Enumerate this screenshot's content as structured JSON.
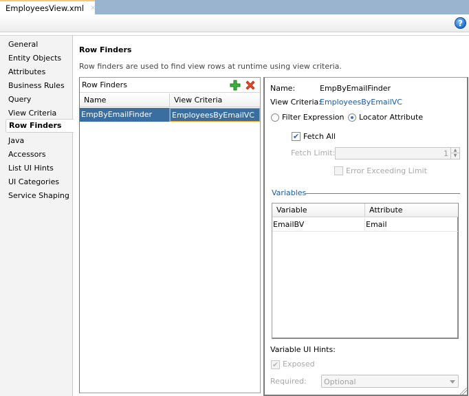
{
  "tab": {
    "title": "EmployeesView.xml",
    "close_glyph": "×"
  },
  "toolbar": {
    "help_glyph": "?"
  },
  "nav": {
    "items": [
      {
        "label": "General"
      },
      {
        "label": "Entity Objects"
      },
      {
        "label": "Attributes"
      },
      {
        "label": "Business Rules"
      },
      {
        "label": "Query"
      },
      {
        "label": "View Criteria"
      },
      {
        "label": "Row Finders"
      },
      {
        "label": "Java"
      },
      {
        "label": "Accessors"
      },
      {
        "label": "List UI Hints"
      },
      {
        "label": "UI Categories"
      },
      {
        "label": "Service Shaping"
      }
    ],
    "active": "Row Finders"
  },
  "main": {
    "title": "Row Finders",
    "description": "Row finders are used to find view rows at runtime using view criteria.",
    "finders_table": {
      "header": "Row Finders",
      "columns": [
        "Name",
        "View Criteria"
      ],
      "rows": [
        {
          "name": "EmpByEmailFinder",
          "view_criteria": "EmployeesByEmailVC",
          "selected": true
        }
      ]
    }
  },
  "detail": {
    "name_label": "Name:",
    "name_value": "EmpByEmailFinder",
    "vc_label": "View Criteria:",
    "vc_value": "EmployeesByEmailVC",
    "radio_filter": "Filter Expression",
    "radio_locator": "Locator Attribute",
    "radio_selected": "Locator Attribute",
    "fetch_all_label": "Fetch All",
    "fetch_all_checked": true,
    "fetch_limit_label": "Fetch Limit:",
    "fetch_limit_value": "1",
    "error_exceeding_label": "Error Exceeding Limit",
    "error_exceeding_checked": false,
    "variables_group": "Variables",
    "variables_table": {
      "columns": [
        "Variable",
        "Attribute"
      ],
      "rows": [
        {
          "variable": "EmailBV",
          "attribute": "Email"
        }
      ]
    },
    "ui_hints_label": "Variable UI Hints:",
    "exposed_label": "Exposed",
    "exposed_checked": true,
    "required_label": "Required:",
    "required_value": "Optional"
  },
  "colors": {
    "selection": "#3b6ea0",
    "link": "#1a5aa6",
    "tabstrip": "#9ab4d0"
  }
}
